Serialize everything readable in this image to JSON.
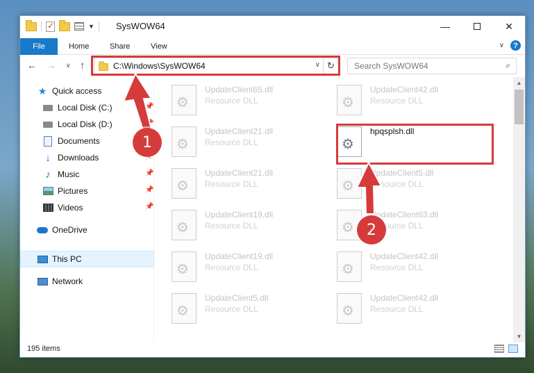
{
  "window": {
    "title": "SysWOW64",
    "minimize": "—",
    "close": "✕"
  },
  "ribbon": {
    "tabs": [
      "File",
      "Home",
      "Share",
      "View"
    ],
    "expand": "∨",
    "help": "?"
  },
  "nav": {
    "back": "←",
    "forward": "→",
    "recent": "∨",
    "up": "↑",
    "address": "C:\\Windows\\SysWOW64",
    "address_dropdown": "∨",
    "refresh": "↻",
    "search_placeholder": "Search SysWOW64",
    "search_icon": "⌕"
  },
  "sidebar": {
    "items": [
      {
        "label": "Quick access",
        "icon": "star-icon",
        "pinned": false
      },
      {
        "label": "Local Disk (C:)",
        "icon": "drive-icon",
        "pinned": true
      },
      {
        "label": "Local Disk (D:)",
        "icon": "drive-icon",
        "pinned": true
      },
      {
        "label": "Documents",
        "icon": "documents-icon",
        "pinned": true
      },
      {
        "label": "Downloads",
        "icon": "download-icon",
        "pinned": true
      },
      {
        "label": "Music",
        "icon": "music-icon",
        "pinned": true
      },
      {
        "label": "Pictures",
        "icon": "pictures-icon",
        "pinned": true
      },
      {
        "label": "Videos",
        "icon": "videos-icon",
        "pinned": true
      },
      {
        "label": "OneDrive",
        "icon": "cloud-icon",
        "pinned": false
      },
      {
        "label": "This PC",
        "icon": "computer-icon",
        "pinned": false,
        "selected": true
      },
      {
        "label": "Network",
        "icon": "network-icon",
        "pinned": false
      }
    ],
    "pin_glyph": "📌"
  },
  "files": [
    {
      "name": "UpdateClient65.dll",
      "desc": "Resource DLL",
      "faded": true
    },
    {
      "name": "UpdateClient42.dll",
      "desc": "Resource DLL",
      "faded": true
    },
    {
      "name": "UpdateClient21.dll",
      "desc": "Resource DLL",
      "faded": true
    },
    {
      "name": "hpqsplsh.dll",
      "desc": "",
      "faded": false
    },
    {
      "name": "UpdateClient21.dll",
      "desc": "Resource DLL",
      "faded": true
    },
    {
      "name": "UpdateClient5.dll",
      "desc": "Resource DLL",
      "faded": true
    },
    {
      "name": "UpdateClient19.dll",
      "desc": "Resource DLL",
      "faded": true
    },
    {
      "name": "UpdateClient63.dll",
      "desc": "Resource DLL",
      "faded": true
    },
    {
      "name": "UpdateClient19.dll",
      "desc": "Resource DLL",
      "faded": true
    },
    {
      "name": "UpdateClient42.dll",
      "desc": "Resource DLL",
      "faded": true
    },
    {
      "name": "UpdateClient5.dll",
      "desc": "Resource DLL",
      "faded": true
    },
    {
      "name": "UpdateClient42.dll",
      "desc": "Resource DLL",
      "faded": true
    }
  ],
  "status": {
    "item_count": "195 items"
  },
  "scrollbar": {
    "up": "▲",
    "down": "▼"
  },
  "callouts": [
    "1",
    "2"
  ],
  "colors": {
    "accent": "#1979ca",
    "highlight": "#d63b3b"
  }
}
